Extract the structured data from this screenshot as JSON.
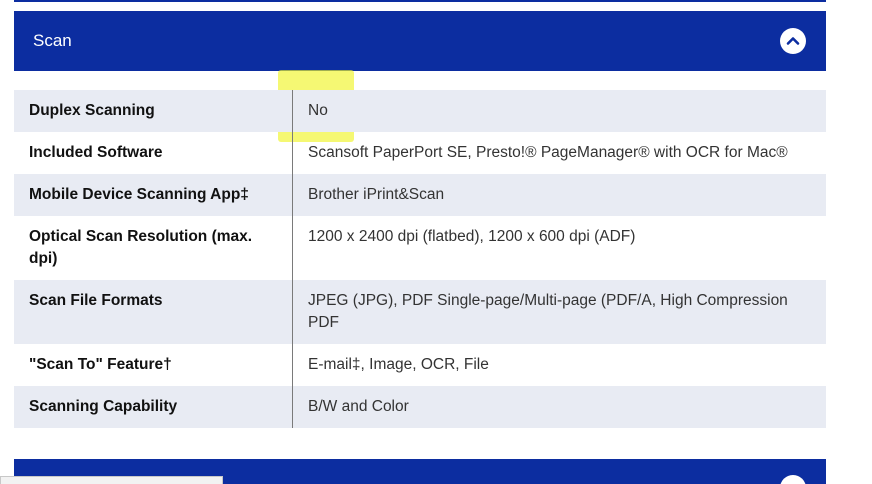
{
  "section": {
    "title": "Scan"
  },
  "rows": [
    {
      "label": "Duplex Scanning",
      "value": "No"
    },
    {
      "label": "Included Software",
      "value": "Scansoft PaperPort SE, Presto!® PageManager® with OCR for Mac®"
    },
    {
      "label": "Mobile Device Scanning App‡",
      "value": "Brother iPrint&Scan"
    },
    {
      "label": "Optical Scan Resolution (max. dpi)",
      "value": "1200 x 2400 dpi (flatbed), 1200 x 600 dpi (ADF)"
    },
    {
      "label": "Scan File Formats",
      "value": "JPEG (JPG), PDF Single-page/Multi-page (PDF/A, High Compression PDF"
    },
    {
      "label": "\"Scan To\" Feature†",
      "value": "E-mail‡, Image, OCR, File"
    },
    {
      "label": "Scanning Capability",
      "value": "B/W and Color"
    }
  ],
  "colors": {
    "header_bg": "#0c2da0",
    "row_shade": "#e8ebf3",
    "highlight": "#f0f528"
  },
  "icons": {
    "toggle": "chevron-up-icon"
  }
}
